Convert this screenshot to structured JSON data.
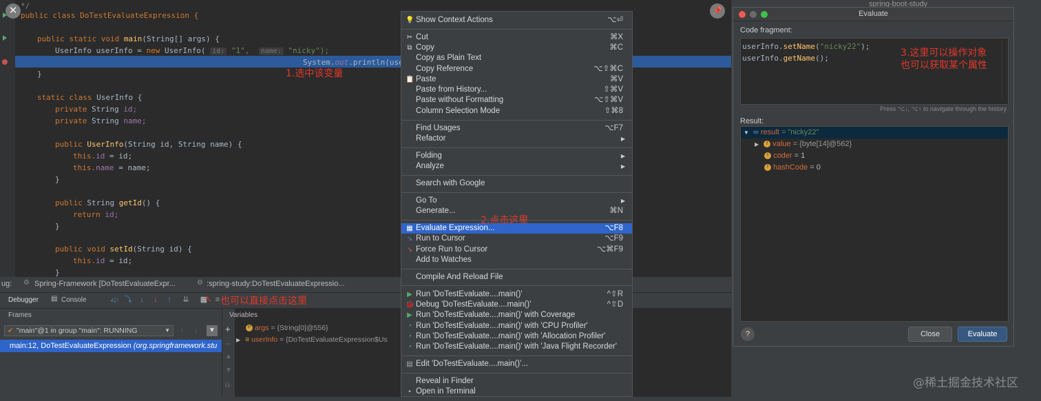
{
  "editor": {
    "lines": {
      "l0": "public class DoTestEvaluateExpression {",
      "l1a": "public static void ",
      "l1b": "main",
      "l1c": "(String[] args) {",
      "l2a": "UserInfo userInfo = ",
      "l2b": "new ",
      "l2c": "UserInfo( ",
      "l2h1": "id:",
      "l2d": " \"1\",  ",
      "l2h2": "name:",
      "l2e": " \"nicky\");",
      "l3a": "System.",
      "l3b": "out",
      "l3c": ".println(use",
      "l4": "}",
      "l5a": "static class ",
      "l5b": "UserInfo {",
      "l6a": "private ",
      "l6b": "String ",
      "l6c": "id;",
      "l7a": "private ",
      "l7b": "String ",
      "l7c": "name;",
      "l8a": "public ",
      "l8b": "UserInfo",
      "l8c": "(String id, String name) {",
      "l9a": "this.",
      "l9b": "id",
      "l9c": " = id;",
      "l10a": "this.",
      "l10b": "name",
      "l10c": " = name;",
      "l11": "}",
      "l12a": "public ",
      "l12b": "String ",
      "l12c": "getId",
      "l12d": "() {",
      "l13a": "return ",
      "l13b": "id;",
      "l14": "}",
      "l15a": "public void ",
      "l15b": "setId",
      "l15c": "(String id) {",
      "l16a": "this.",
      "l16b": "id",
      "l16c": " = id;",
      "l17": "}",
      "comment": "*/"
    },
    "annotation1": "1.选中该变量",
    "close_glyph": "✕",
    "pin_glyph": "📌"
  },
  "debug": {
    "prefix": "ug:",
    "tab1": "Spring-Framework [DoTestEvaluateExpr...",
    "tab2": ":spring-study:DoTestEvaluateExpressio...",
    "debugger_label": "Debugger",
    "console_label": "Console",
    "annotation4": "也可以直接点击这里",
    "frames_label": "Frames",
    "variables_label": "Variables",
    "thread": "\"main\"@1 in group \"main\": RUNNING",
    "frame_row": "main:12, DoTestEvaluateExpression",
    "frame_row_pkg": " (org.springframework.stu",
    "var1_name": "args",
    "var1_val": " = {String[0]@556}",
    "var2_name": "userInfo",
    "var2_val": " = {DoTestEvaluateExpression$Us"
  },
  "context_menu": {
    "items": [
      {
        "label": "Show Context Actions",
        "shortcut": "⌥⏎"
      },
      {
        "label": "Cut",
        "shortcut": "⌘X"
      },
      {
        "label": "Copy",
        "shortcut": "⌘C"
      },
      {
        "label": "Copy as Plain Text",
        "shortcut": ""
      },
      {
        "label": "Copy Reference",
        "shortcut": "⌥⇧⌘C"
      },
      {
        "label": "Paste",
        "shortcut": "⌘V"
      },
      {
        "label": "Paste from History...",
        "shortcut": "⇧⌘V"
      },
      {
        "label": "Paste without Formatting",
        "shortcut": "⌥⇧⌘V"
      },
      {
        "label": "Column Selection Mode",
        "shortcut": "⇧⌘8"
      },
      {
        "label": "Find Usages",
        "shortcut": "⌥F7"
      },
      {
        "label": "Refactor",
        "shortcut": ""
      },
      {
        "label": "Folding",
        "shortcut": ""
      },
      {
        "label": "Analyze",
        "shortcut": ""
      },
      {
        "label": "Search with Google",
        "shortcut": ""
      },
      {
        "label": "Go To",
        "shortcut": ""
      },
      {
        "label": "Generate...",
        "shortcut": "⌘N"
      },
      {
        "label": "Evaluate Expression...",
        "shortcut": "⌥F8"
      },
      {
        "label": "Run to Cursor",
        "shortcut": "⌥F9"
      },
      {
        "label": "Force Run to Cursor",
        "shortcut": "⌥⌘F9"
      },
      {
        "label": "Add to Watches",
        "shortcut": ""
      },
      {
        "label": "Compile And Reload File",
        "shortcut": ""
      },
      {
        "label": "Run 'DoTestEvaluate....main()'",
        "shortcut": "^⇧R"
      },
      {
        "label": "Debug 'DoTestEvaluate....main()'",
        "shortcut": "^⇧D"
      },
      {
        "label": "Run 'DoTestEvaluate....main()' with Coverage",
        "shortcut": ""
      },
      {
        "label": "Run 'DoTestEvaluate....main()' with 'CPU Profiler'",
        "shortcut": ""
      },
      {
        "label": "Run 'DoTestEvaluate....main()' with 'Allocation Profiler'",
        "shortcut": ""
      },
      {
        "label": "Run 'DoTestEvaluate....main()' with 'Java Flight Recorder'",
        "shortcut": ""
      },
      {
        "label": "Edit 'DoTestEvaluate....main()'...",
        "shortcut": ""
      },
      {
        "label": "Reveal in Finder",
        "shortcut": ""
      },
      {
        "label": "Open in Terminal",
        "shortcut": ""
      }
    ],
    "annotation2": "2.点击这里"
  },
  "evaluate": {
    "title": "Evaluate",
    "code_fragment_label": "Code fragment:",
    "code1a": "userInfo.",
    "code1b": "setName",
    "code1c": "(",
    "code1d": "\"nicky22\"",
    "code1e": ");",
    "code2a": "userInfo.",
    "code2b": "getName",
    "code2c": "();",
    "annotation3_line1": "3.这里可以操作对象",
    "annotation3_line2": "也可以获取某个属性",
    "history_hint": "Press ⌥↓, ⌥↑ to navigate through the history",
    "result_label": "Result:",
    "result_name": "result",
    "result_val": " = \"nicky22\"",
    "rows": [
      {
        "name": "value",
        "val": " = {byte[14]@562}"
      },
      {
        "name": "coder",
        "val": " = 1"
      },
      {
        "name": "hashCode",
        "val": " = 0"
      }
    ],
    "help_label": "?",
    "close_label": "Close",
    "evaluate_label": "Evaluate"
  },
  "background": {
    "project_item": "spring-boot-study",
    "watermark": "@稀土掘金技术社区"
  },
  "colors": {
    "accent": "#2f65ca",
    "annotation": "#e0392b"
  }
}
